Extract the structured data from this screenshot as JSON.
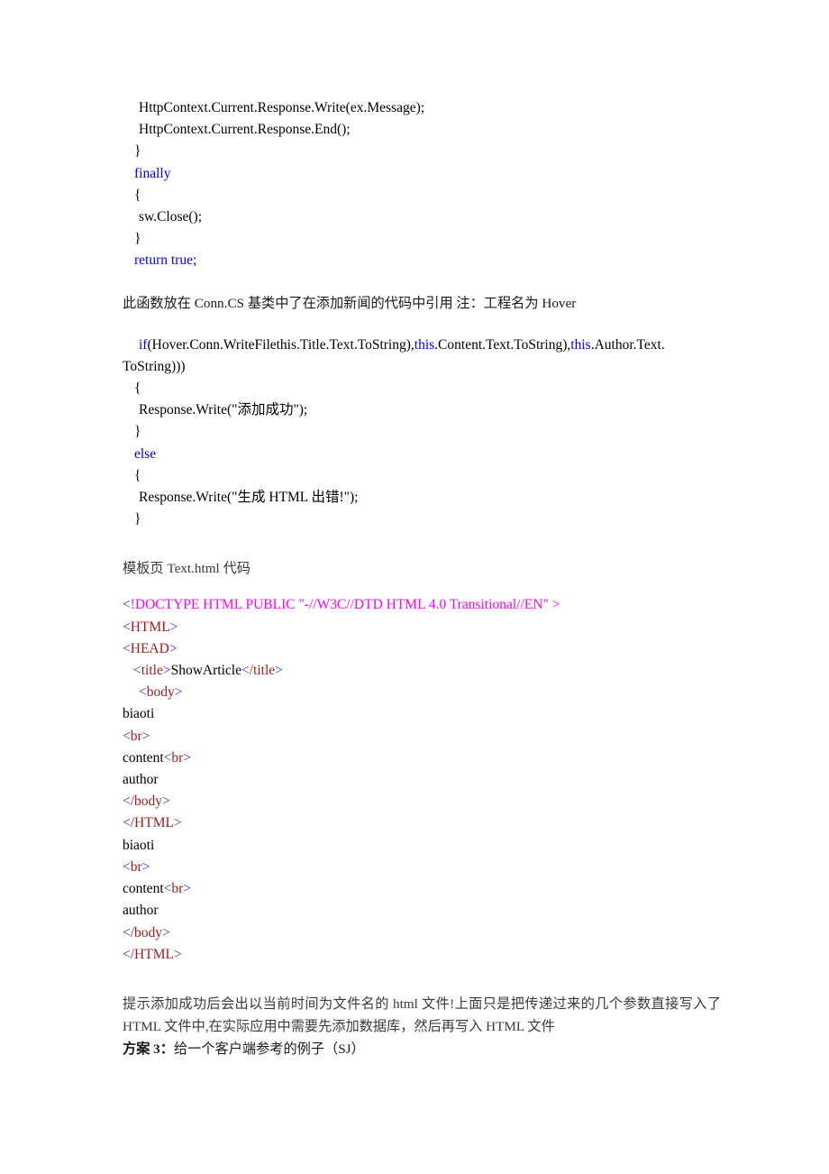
{
  "document": {
    "language": "zh-CN",
    "colors": {
      "keyword_blue": "#0000ff",
      "tag_red": "#9e1a1a",
      "bracket_blue": "#2b2bdd",
      "doctype_magenta": "#ff00ff",
      "body_text": "#1a1a1a",
      "background": "#ffffff"
    }
  },
  "code_block_1": {
    "lines": [
      {
        "indent": 1,
        "segments": [
          {
            "text": "HttpContext.Current.Response.Write(ex.Message);",
            "style": "plain"
          }
        ]
      },
      {
        "indent": 1,
        "segments": [
          {
            "text": "HttpContext.Current.Response.End();",
            "style": "plain"
          }
        ]
      },
      {
        "indent": 0,
        "segments": [
          {
            "text": "}",
            "style": "plain"
          }
        ]
      },
      {
        "indent": 0,
        "segments": [
          {
            "text": "finally",
            "style": "keyword"
          }
        ]
      },
      {
        "indent": 0,
        "segments": [
          {
            "text": "{",
            "style": "plain"
          }
        ]
      },
      {
        "indent": 1,
        "segments": [
          {
            "text": "sw.Close();",
            "style": "plain"
          }
        ]
      },
      {
        "indent": 0,
        "segments": [
          {
            "text": "}",
            "style": "plain"
          }
        ]
      },
      {
        "indent": 0,
        "segments": [
          {
            "text": "return true;",
            "style": "keyword"
          }
        ]
      }
    ]
  },
  "paragraph_1": {
    "text": "此函数放在 Conn.CS 基类中了在添加新闻的代码中引用 注：工程名为 Hover"
  },
  "code_block_2": {
    "if_line": {
      "segments": [
        {
          "text": "if",
          "style": "keyword"
        },
        {
          "text": "(Hover.Conn.WriteFilethis.Title.Text.ToString),",
          "style": "plain"
        },
        {
          "text": "this",
          "style": "keyword"
        },
        {
          "text": ".Content.Text.ToString),",
          "style": "plain"
        },
        {
          "text": "this",
          "style": "keyword"
        },
        {
          "text": ".Author.Text.",
          "style": "plain"
        }
      ],
      "continuation": "ToString)))"
    },
    "lines": [
      {
        "indent": 0,
        "segments": [
          {
            "text": "{",
            "style": "plain"
          }
        ]
      },
      {
        "indent": 1,
        "segments": [
          {
            "text": "Response.Write(\"添加成功\");",
            "style": "plain"
          }
        ]
      },
      {
        "indent": 0,
        "segments": [
          {
            "text": "}",
            "style": "plain"
          }
        ]
      },
      {
        "indent": 0,
        "segments": [
          {
            "text": "else",
            "style": "keyword"
          }
        ]
      },
      {
        "indent": 0,
        "segments": [
          {
            "text": "{",
            "style": "plain"
          }
        ]
      },
      {
        "indent": 1,
        "segments": [
          {
            "text": "Response.Write(\"生成 HTML 出错!\");",
            "style": "plain"
          }
        ]
      },
      {
        "indent": 0,
        "segments": [
          {
            "text": "}",
            "style": "plain"
          }
        ]
      }
    ]
  },
  "template_heading": {
    "text": "模板页 Text.html 代码"
  },
  "html_template": {
    "lines": [
      {
        "indent": "a",
        "segments": [
          {
            "text": "<",
            "style": "bracket"
          },
          {
            "text": "!DOCTYPE HTML PUBLIC \"-//W3C//DTD HTML 4.0 Transitional//EN\" >",
            "style": "doctype"
          }
        ]
      },
      {
        "indent": "a",
        "segments": [
          {
            "text": "<",
            "style": "bracket"
          },
          {
            "text": "HTML",
            "style": "tag"
          },
          {
            "text": ">",
            "style": "bracket"
          }
        ]
      },
      {
        "indent": "a",
        "segments": [
          {
            "text": "<",
            "style": "bracket"
          },
          {
            "text": "HEAD",
            "style": "tag"
          },
          {
            "text": ">",
            "style": "bracket"
          }
        ]
      },
      {
        "indent": "b",
        "segments": [
          {
            "text": "<",
            "style": "bracket"
          },
          {
            "text": "title",
            "style": "tag"
          },
          {
            "text": ">",
            "style": "bracket"
          },
          {
            "text": "ShowArticle",
            "style": "text"
          },
          {
            "text": "<",
            "style": "bracket"
          },
          {
            "text": "/title",
            "style": "tag"
          },
          {
            "text": ">",
            "style": "bracket"
          }
        ]
      },
      {
        "indent": "c",
        "segments": [
          {
            "text": "<",
            "style": "bracket"
          },
          {
            "text": "body",
            "style": "tag"
          },
          {
            "text": ">",
            "style": "bracket"
          }
        ]
      },
      {
        "indent": "a",
        "segments": [
          {
            "text": "biaoti",
            "style": "text"
          }
        ]
      },
      {
        "indent": "a",
        "segments": [
          {
            "text": "<",
            "style": "bracket"
          },
          {
            "text": "br",
            "style": "tag"
          },
          {
            "text": ">",
            "style": "bracket"
          }
        ]
      },
      {
        "indent": "a",
        "segments": [
          {
            "text": "content",
            "style": "text"
          },
          {
            "text": "<",
            "style": "bracket"
          },
          {
            "text": "br",
            "style": "tag"
          },
          {
            "text": ">",
            "style": "bracket"
          }
        ]
      },
      {
        "indent": "a",
        "segments": [
          {
            "text": "author",
            "style": "text"
          }
        ]
      },
      {
        "indent": "a",
        "segments": [
          {
            "text": "<",
            "style": "bracket"
          },
          {
            "text": "/body",
            "style": "tag"
          },
          {
            "text": ">",
            "style": "bracket"
          }
        ]
      },
      {
        "indent": "a",
        "segments": [
          {
            "text": "<",
            "style": "bracket"
          },
          {
            "text": "/HTML",
            "style": "tag"
          },
          {
            "text": ">",
            "style": "bracket"
          }
        ]
      },
      {
        "indent": "a",
        "segments": [
          {
            "text": "biaoti",
            "style": "text"
          }
        ]
      },
      {
        "indent": "a",
        "segments": [
          {
            "text": "<",
            "style": "bracket"
          },
          {
            "text": "br",
            "style": "tag"
          },
          {
            "text": ">",
            "style": "bracket"
          }
        ]
      },
      {
        "indent": "a",
        "segments": [
          {
            "text": "content",
            "style": "text"
          },
          {
            "text": "<",
            "style": "bracket"
          },
          {
            "text": "br",
            "style": "tag"
          },
          {
            "text": ">",
            "style": "bracket"
          }
        ]
      },
      {
        "indent": "a",
        "segments": [
          {
            "text": "author",
            "style": "text"
          }
        ]
      },
      {
        "indent": "a",
        "segments": [
          {
            "text": "<",
            "style": "bracket"
          },
          {
            "text": "/body",
            "style": "tag"
          },
          {
            "text": ">",
            "style": "bracket"
          }
        ]
      },
      {
        "indent": "a",
        "segments": [
          {
            "text": "<",
            "style": "bracket"
          },
          {
            "text": "/HTML",
            "style": "tag"
          },
          {
            "text": ">",
            "style": "bracket"
          }
        ]
      }
    ]
  },
  "paragraph_2": {
    "text": "提示添加成功后会出以当前时间为文件名的 html 文件!上面只是把传递过来的几个参数直接写入了 HTML 文件中,在实际应用中需要先添加数据库，然后再写入 HTML 文件"
  },
  "paragraph_3": {
    "bold_prefix": "方案 3：",
    "rest": "给一个客户端参考的例子（SJ）"
  }
}
